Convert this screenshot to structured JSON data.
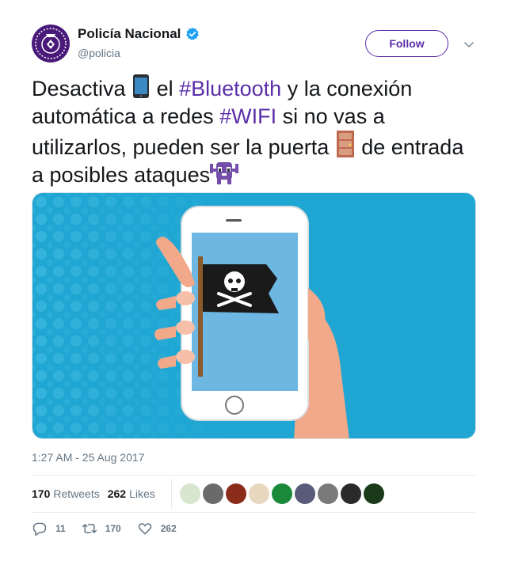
{
  "account": {
    "name": "Policía Nacional",
    "handle": "@policia",
    "avatar_icon": "police-badge-icon",
    "verified_icon": "verified-badge-icon",
    "brand_color": "#4a1a7a"
  },
  "follow_label": "Follow",
  "tweet": {
    "part1": "Desactiva ",
    "part2": " el ",
    "hashtag1": "#Bluetooth",
    "part3": " y la conexión automática a redes ",
    "hashtag2": "#WIFI",
    "part4": " si no vas a utilizarlos, pueden ser la puerta ",
    "part5": " de entrada a posibles ataques",
    "emoji_icons": [
      "phone-icon",
      "door-icon",
      "space-invader-icon"
    ],
    "hashtag_color": "#5b2ea8"
  },
  "media": {
    "description_icon": "hand-phone-pirate-flag-image",
    "bg_color": "#1fa6d2"
  },
  "timestamp": "1:27 AM - 25 Aug 2017",
  "stats": {
    "retweets_count": "170",
    "retweets_label": "Retweets",
    "likes_count": "262",
    "likes_label": "Likes",
    "liker_colors": [
      "#d8e6d0",
      "#6a6a6a",
      "#8b2c1a",
      "#e8d8c0",
      "#1a8a3a",
      "#5a5a7a",
      "#7a7a7a",
      "#2a2a2a",
      "#1a3a1a"
    ]
  },
  "actions": {
    "reply_count": "11",
    "retweet_count": "170",
    "like_count": "262"
  }
}
